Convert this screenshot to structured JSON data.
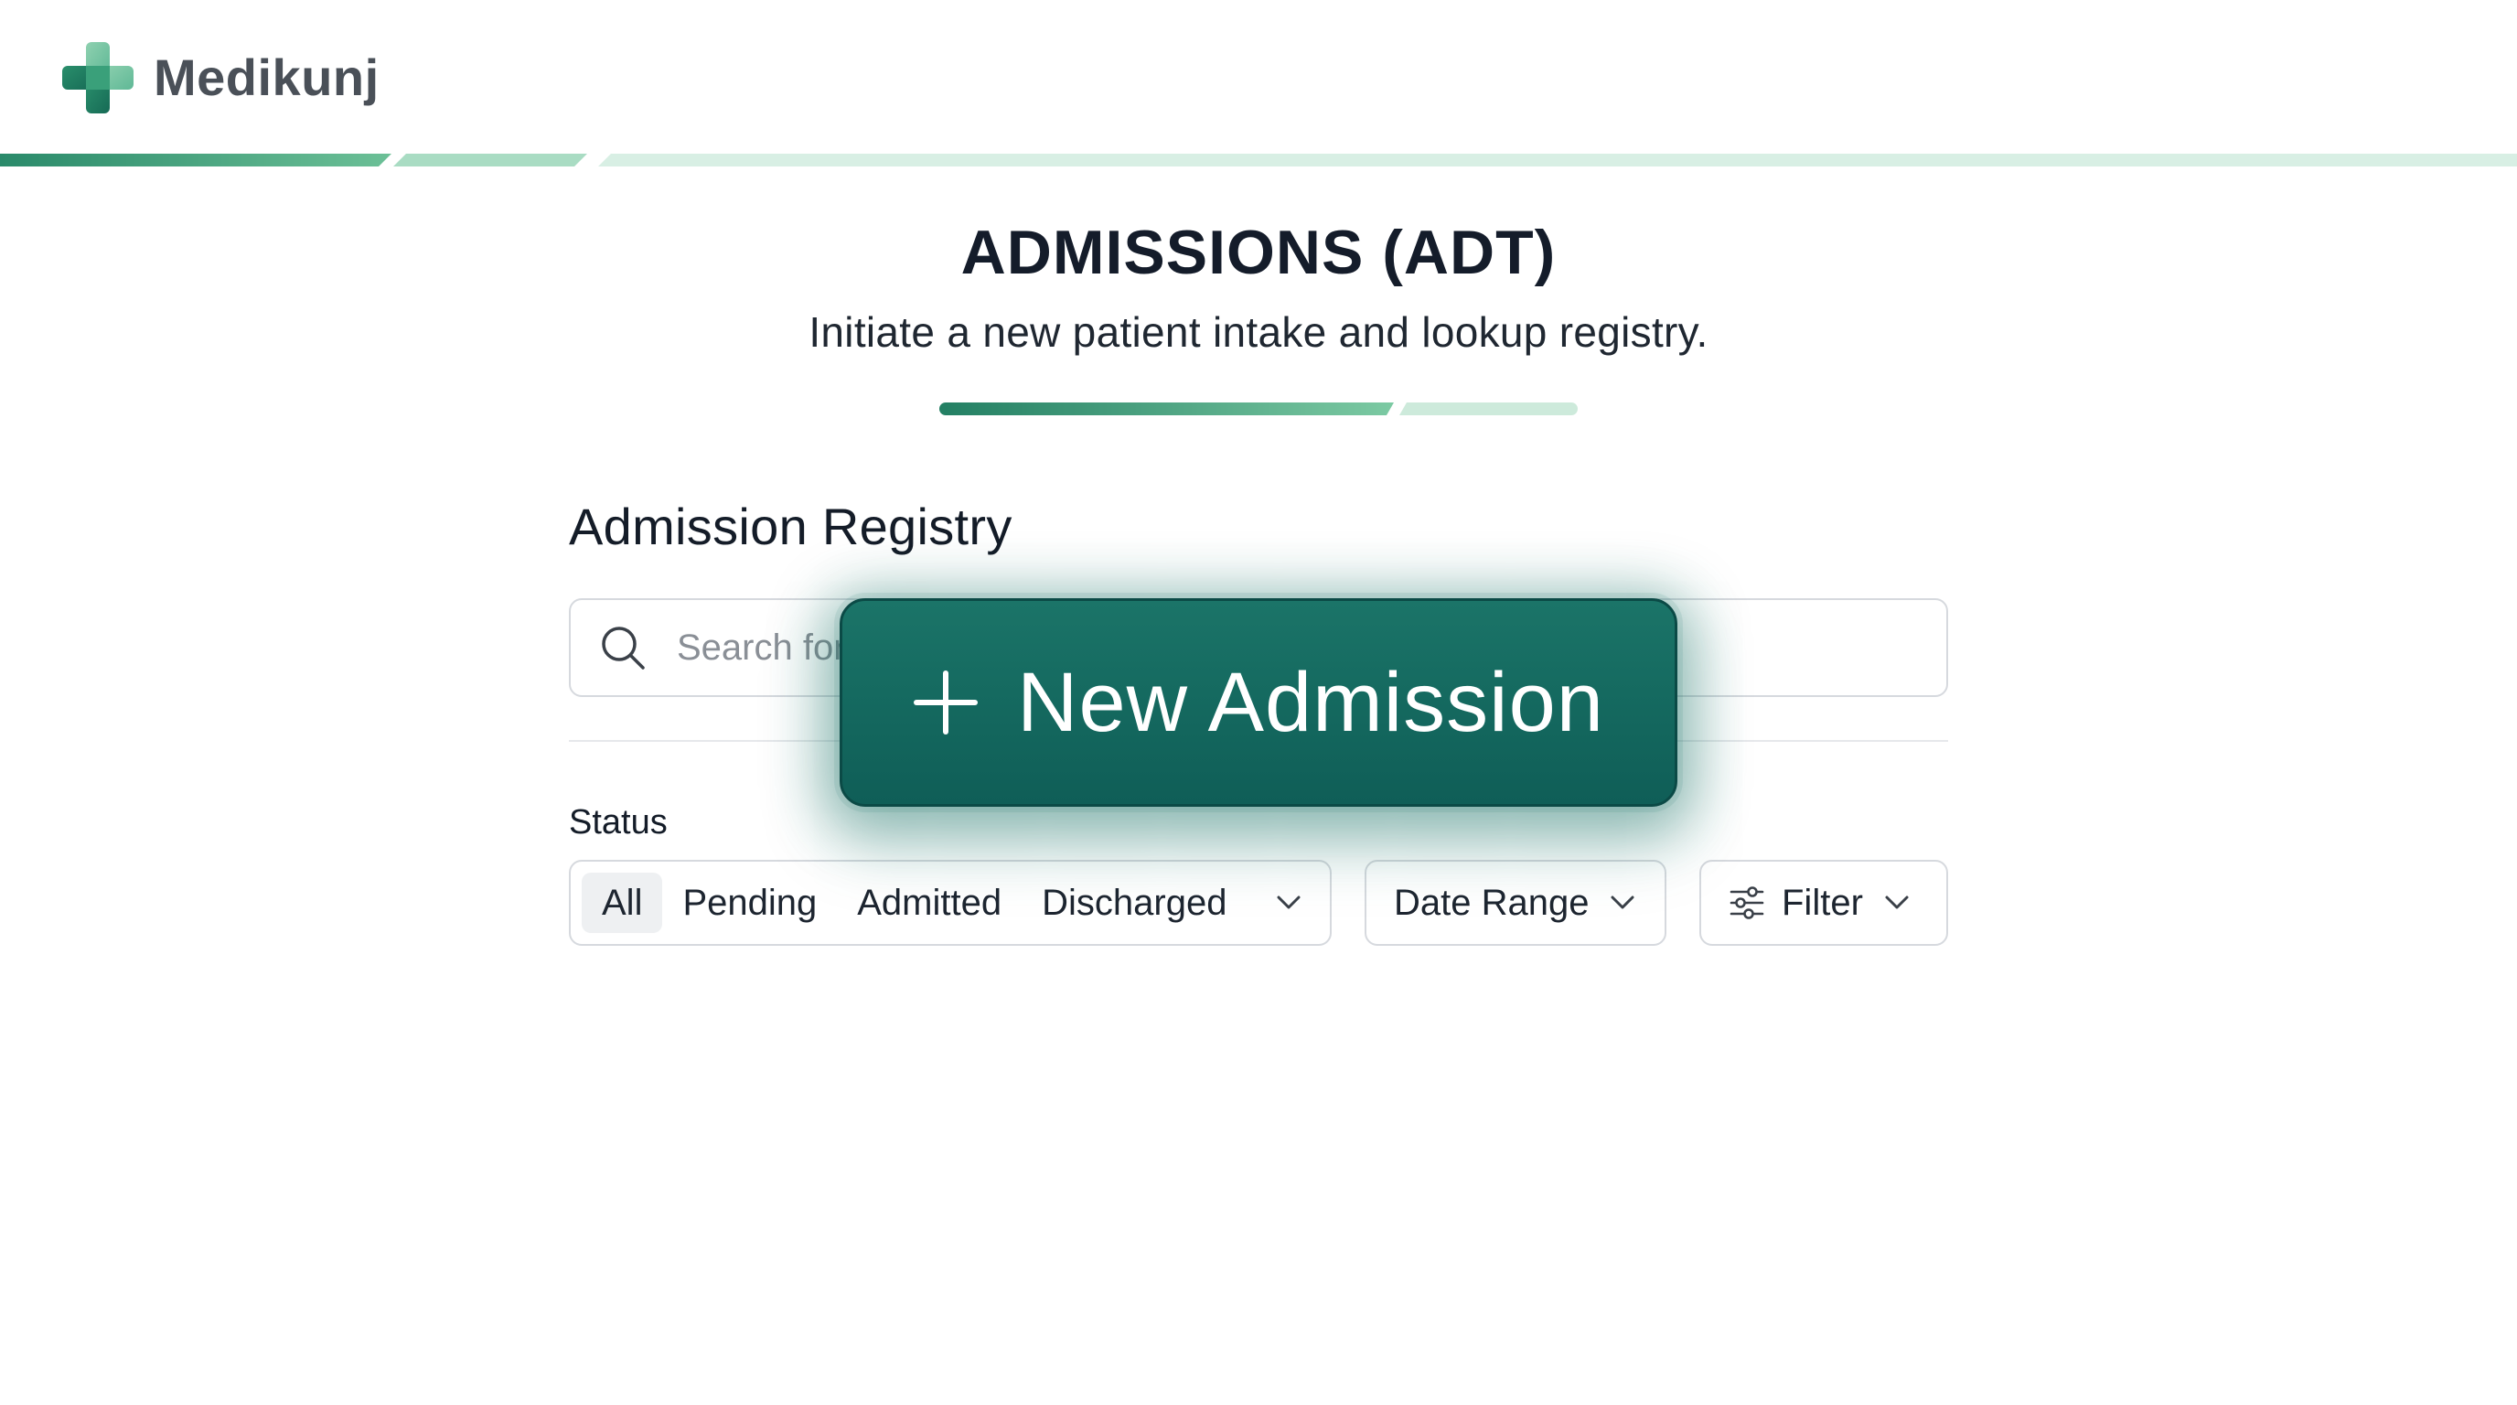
{
  "brand": {
    "name": "Medikunj",
    "logo_icon": "medical-cross-icon"
  },
  "header": {
    "title": "ADMISSIONS (ADT)",
    "subtitle": "Initiate a new patient intake and lookup registry."
  },
  "registry": {
    "section_title": "Admission Registry",
    "search": {
      "placeholder": "Search for",
      "value": "",
      "icon": "search-icon"
    },
    "status_label": "Status",
    "status_options": [
      "All",
      "Pending",
      "Admitted",
      "Discharged"
    ],
    "status_selected": "All",
    "date_range_label": "Date Range",
    "filter_label": "Filter"
  },
  "primary_action": {
    "label": "New Admission",
    "icon": "plus-icon"
  },
  "colors": {
    "accent": "#1b7468",
    "accent_dark": "#0f5e57",
    "accent_light": "#d6eee5",
    "stripe_green": "#3fa77d",
    "text_primary": "#141c2a",
    "brand_text": "#4a5058",
    "border": "#d6d9de"
  }
}
